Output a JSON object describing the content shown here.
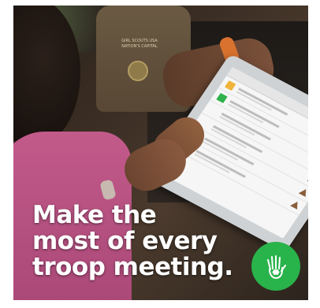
{
  "vest": {
    "badge_text": "GIRL SCOUTS USA NATION'S CAPITAL"
  },
  "headline": {
    "line1": "Make the",
    "line2": "most of every",
    "line3": "troop meeting."
  },
  "colors": {
    "logo_green": "#29b34b",
    "text": "#ffffff",
    "shirt_pink": "#c25a8a"
  },
  "icons": {
    "logo": "hand-trefoil-icon"
  }
}
